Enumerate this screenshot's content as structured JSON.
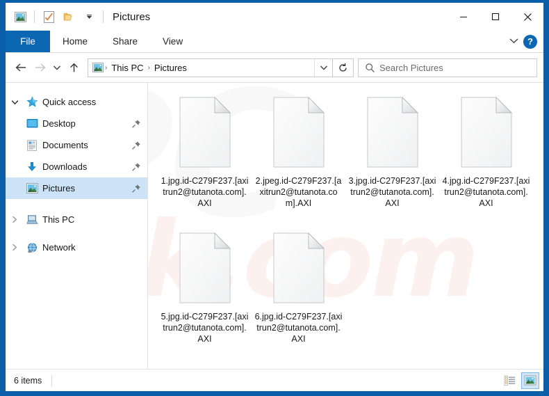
{
  "window": {
    "title": "Pictures",
    "quick_access_toolbar": [
      {
        "name": "pictures-folder-icon",
        "label": "Pictures"
      },
      {
        "name": "properties-icon",
        "label": "Properties"
      },
      {
        "name": "new-folder-icon",
        "label": "New folder"
      },
      {
        "name": "customize-chevron-icon",
        "label": "Customize Quick Access Toolbar"
      }
    ],
    "controls": {
      "minimize": "–",
      "maximize": "□",
      "close": "✕"
    }
  },
  "ribbon": {
    "tabs": [
      {
        "label": "File",
        "active": true
      },
      {
        "label": "Home",
        "active": false
      },
      {
        "label": "Share",
        "active": false
      },
      {
        "label": "View",
        "active": false
      }
    ],
    "expand_label": "⌄",
    "help_label": "?"
  },
  "address_bar": {
    "back_label": "←",
    "forward_label": "→",
    "recent_label": "⌄",
    "up_label": "↑",
    "breadcrumb": [
      {
        "label": "This PC"
      },
      {
        "label": "Pictures"
      }
    ],
    "breadcrumb_separator": "›",
    "dropdown_label": "⌄",
    "refresh_label": "↻"
  },
  "search": {
    "placeholder": "Search Pictures",
    "value": "",
    "icon": "search-icon"
  },
  "sidebar": {
    "items": [
      {
        "label": "Quick access",
        "icon": "star-icon",
        "twisty": "˅",
        "level": 0,
        "selected": false,
        "pinned": false
      },
      {
        "label": "Desktop",
        "icon": "desktop-icon",
        "twisty": "",
        "level": 1,
        "selected": false,
        "pinned": true
      },
      {
        "label": "Documents",
        "icon": "documents-icon",
        "twisty": "",
        "level": 1,
        "selected": false,
        "pinned": true
      },
      {
        "label": "Downloads",
        "icon": "downloads-icon",
        "twisty": "",
        "level": 1,
        "selected": false,
        "pinned": true
      },
      {
        "label": "Pictures",
        "icon": "pictures-icon",
        "twisty": "",
        "level": 1,
        "selected": true,
        "pinned": true
      },
      {
        "label": "This PC",
        "icon": "thispc-icon",
        "twisty": "›",
        "level": 0,
        "selected": false,
        "pinned": false
      },
      {
        "label": "Network",
        "icon": "network-icon",
        "twisty": "›",
        "level": 0,
        "selected": false,
        "pinned": false
      }
    ]
  },
  "files": [
    {
      "name": "1.jpg.id-C279F237.[axitrun2@tutanota.com].AXI",
      "icon": "generic-file-icon"
    },
    {
      "name": "2.jpeg.id-C279F237.[axitrun2@tutanota.com].AXI",
      "icon": "generic-file-icon"
    },
    {
      "name": "3.jpg.id-C279F237.[axitrun2@tutanota.com].AXI",
      "icon": "generic-file-icon"
    },
    {
      "name": "4.jpg.id-C279F237.[axitrun2@tutanota.com].AXI",
      "icon": "generic-file-icon"
    },
    {
      "name": "5.jpg.id-C279F237.[axitrun2@tutanota.com].AXI",
      "icon": "generic-file-icon"
    },
    {
      "name": "6.jpg.id-C279F237.[axitrun2@tutanota.com].AXI",
      "icon": "generic-file-icon"
    }
  ],
  "status_bar": {
    "item_count": "6 items",
    "views": [
      {
        "name": "details-view-button",
        "active": false
      },
      {
        "name": "large-icons-view-button",
        "active": true
      }
    ]
  },
  "watermark": {
    "primary": "PC",
    "secondary": "risk.com"
  },
  "colors": {
    "frame_blue": "#0b5ea8",
    "accent_blue": "#0b67b2",
    "selection_blue": "#cce3f7",
    "watermark_pink": "#e9786e"
  }
}
